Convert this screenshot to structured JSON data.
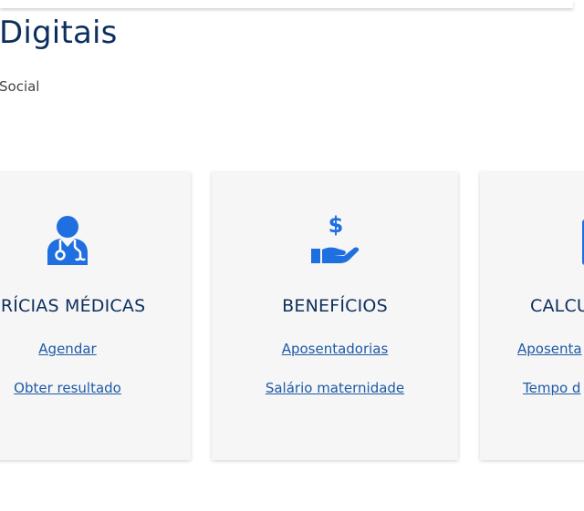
{
  "header": {
    "title": "Digitais",
    "subtitle": "Social"
  },
  "colors": {
    "title": "#0d2f5e",
    "link": "#1e5aa6",
    "icon": "#1f6fe0",
    "card_bg": "#f6f6f6"
  },
  "cards": [
    {
      "title": "ERÍCIAS MÉDICAS",
      "icon": "doctor-icon",
      "links": [
        "Agendar",
        "Obter resultado"
      ]
    },
    {
      "title": "BENEFÍCIOS",
      "icon": "hand-money-icon",
      "links": [
        "Aposentadorias",
        "Salário maternidade"
      ]
    },
    {
      "title": "CALCU",
      "icon": "calculator-icon",
      "links": [
        "Aposenta",
        "Tempo d"
      ]
    }
  ]
}
